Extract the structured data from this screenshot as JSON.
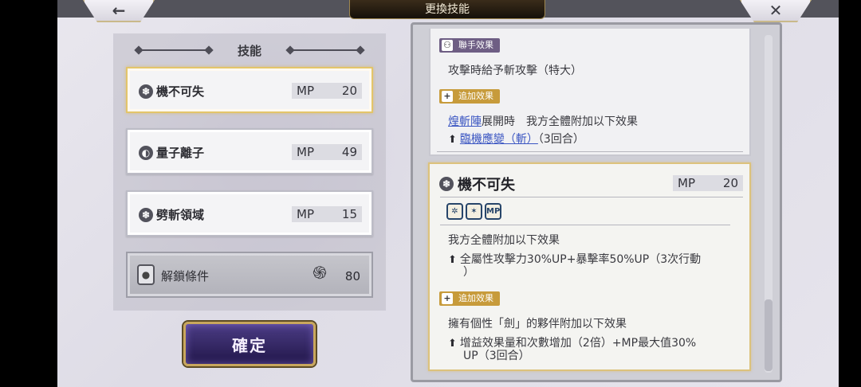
{
  "header": {
    "title": "更換技能",
    "back_icon": "←",
    "close_icon": "✕"
  },
  "skills_panel": {
    "title": "技能",
    "skills": [
      {
        "name": "機不可失",
        "icon": "❄",
        "mp_label": "MP",
        "mp": "20",
        "selected": true
      },
      {
        "name": "量子離子",
        "icon": "◐",
        "mp_label": "MP",
        "mp": "49",
        "selected": false
      },
      {
        "name": "劈斬領域",
        "icon": "❄",
        "mp_label": "MP",
        "mp": "15",
        "selected": false
      }
    ],
    "unlock": {
      "label": "解鎖條件",
      "cost": "80",
      "spiral_icon": "֍",
      "lock_icon": "🔒"
    }
  },
  "confirm_label": "確定",
  "detail_prev": {
    "combo_tag": "聯手效果",
    "combo_text": "攻擊時給予斬攻擊（特大）",
    "extra_tag": "追加效果",
    "extra_link": "煌斬陣",
    "extra_text": "展開時　我方全體附加以下效果",
    "extra_effect_link": "臨機應變（斬）",
    "extra_effect_suffix": "（3回合）"
  },
  "detail_current": {
    "name": "機不可失",
    "icon": "❄",
    "mp_label": "MP",
    "mp": "20",
    "attr_icons": [
      "✲",
      "✶",
      "MP"
    ],
    "effect_intro": "我方全體附加以下效果",
    "effect_line1": "全屬性攻擊力30%UP+暴擊率50%UP（3次行動",
    "effect_line2": "）",
    "extra_tag": "追加效果",
    "extra_intro": "擁有個性「劍」的夥伴附加以下效果",
    "extra_line1": "增益效果量和次數增加（2倍）+MP最大值30%",
    "extra_line2": "UP（3回合）"
  }
}
